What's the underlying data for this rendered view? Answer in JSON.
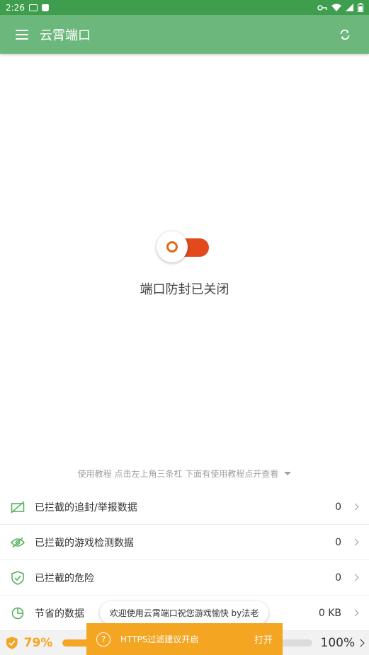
{
  "status_bar": {
    "time": "2:26"
  },
  "app_bar": {
    "title": "云霄端口"
  },
  "toggle": {
    "status_text": "端口防封已关闭",
    "on": false
  },
  "hint": {
    "text": "使用教程 点击左上角三条杠 下面有使用教程点开查看"
  },
  "list": {
    "items": [
      {
        "label": "已拦截的追封/举报数据",
        "value": "0",
        "icon": "no-signal-icon"
      },
      {
        "label": "已拦截的游戏检测数据",
        "value": "0",
        "icon": "eye-off-icon"
      },
      {
        "label": "已拦截的危险",
        "value": "0",
        "icon": "shield-check-icon"
      },
      {
        "label": "节省的数据",
        "value": "0 KB",
        "icon": "pie-chart-icon"
      }
    ]
  },
  "bottom_bar": {
    "left_percent": "79%",
    "right_percent": "100%",
    "progress": 0.2
  },
  "toast": {
    "text": "欢迎使用云霄端口祝您游戏愉快 by法老"
  },
  "snackbar": {
    "text": "HTTPS过滤建议开启",
    "action": "打开"
  },
  "colors": {
    "primary": "#6cb77b",
    "status": "#3f9d4e",
    "accent": "#f4a623",
    "toggle_off": "#e24a1d"
  }
}
